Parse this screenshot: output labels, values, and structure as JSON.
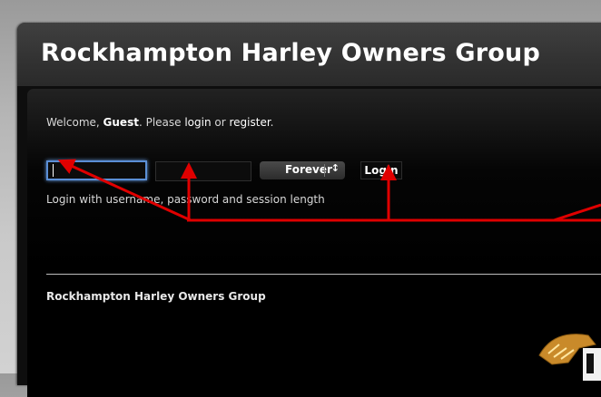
{
  "header": {
    "site_title": "Rockhampton Harley Owners Group"
  },
  "login": {
    "welcome_prefix": "Welcome, ",
    "guest_name": "Guest",
    "welcome_middle": ". Please ",
    "login_link": "login",
    "or_text": " or ",
    "register_link": "register",
    "end_period": ".",
    "username_value": "",
    "password_value": "",
    "session_length": "Forever",
    "login_button": "Login",
    "hint": "Login with username, password and session length"
  },
  "footer": {
    "title": "Rockhampton Harley Owners Group"
  },
  "icons": {
    "select_arrows": "up-down-arrows-icon",
    "logo": "harley-eagle-logo"
  },
  "colors": {
    "annotation_arrow": "#e00000",
    "focus_ring": "#5b8fd6",
    "page_background": "#000000"
  }
}
